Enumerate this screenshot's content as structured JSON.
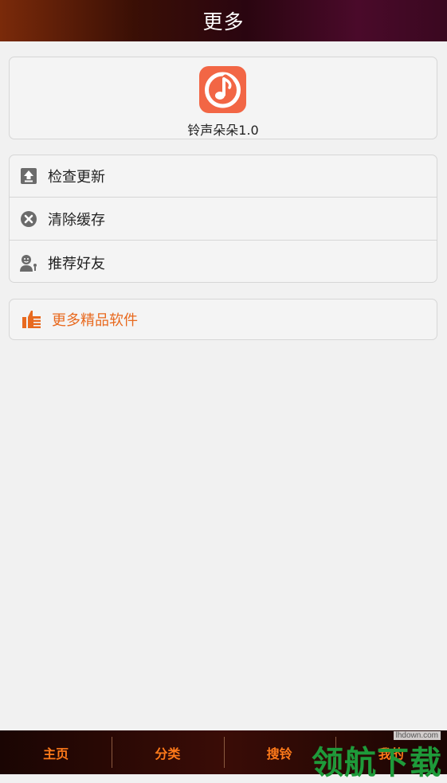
{
  "header": {
    "title": "更多"
  },
  "app": {
    "name": "铃声朵朵1.0",
    "icon": "music-note-icon",
    "icon_color": "#f26645"
  },
  "menu": {
    "items": [
      {
        "label": "检查更新",
        "icon": "upload-icon"
      },
      {
        "label": "清除缓存",
        "icon": "clear-circle-icon"
      },
      {
        "label": "推荐好友",
        "icon": "recommend-friend-icon"
      }
    ]
  },
  "more": {
    "label": "更多精品软件",
    "icon": "thumbs-up-icon",
    "color": "#e8691e"
  },
  "bottom_tabs": [
    {
      "label": "主页"
    },
    {
      "label": "分类"
    },
    {
      "label": "搜铃"
    },
    {
      "label": "我的"
    }
  ],
  "watermark": {
    "brand": "领航下载",
    "domain": "lhdown.com"
  }
}
